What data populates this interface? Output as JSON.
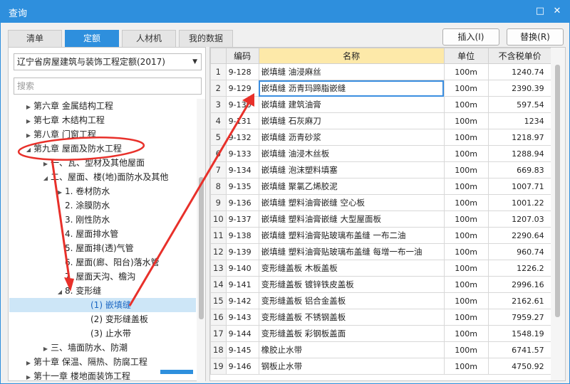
{
  "window": {
    "title": "查询",
    "max_glyph": "□",
    "close_glyph": "✕"
  },
  "tabs": [
    {
      "label": "清单",
      "active": false
    },
    {
      "label": "定额",
      "active": true
    },
    {
      "label": "人材机",
      "active": false
    },
    {
      "label": "我的数据",
      "active": false
    }
  ],
  "actions": {
    "insert_label": "插入(I)",
    "replace_label": "替换(R)"
  },
  "left": {
    "library": "辽宁省房屋建筑与装饰工程定额(2017)",
    "search_placeholder": "搜索",
    "tree": [
      {
        "label": "第六章 金属结构工程",
        "level": 0,
        "toggle": "▶"
      },
      {
        "label": "第七章 木结构工程",
        "level": 0,
        "toggle": "▶"
      },
      {
        "label": "第八章 门窗工程",
        "level": 0,
        "toggle": "▶"
      },
      {
        "label": "第九章 屋面及防水工程",
        "level": 0,
        "toggle": "◢"
      },
      {
        "label": "一、瓦、型材及其他屋面",
        "level": 1,
        "toggle": "▶"
      },
      {
        "label": "二、屋面、楼(地)面防水及其他",
        "level": 1,
        "toggle": "◢"
      },
      {
        "label": "1. 卷材防水",
        "level": 2,
        "toggle": "▶"
      },
      {
        "label": "2. 涂膜防水",
        "level": 2,
        "toggle": ""
      },
      {
        "label": "3. 刚性防水",
        "level": 2,
        "toggle": ""
      },
      {
        "label": "4. 屋面排水管",
        "level": 2,
        "toggle": ""
      },
      {
        "label": "5. 屋面排(透)气管",
        "level": 2,
        "toggle": ""
      },
      {
        "label": "6. 屋面(廊、阳台)落水管",
        "level": 2,
        "toggle": ""
      },
      {
        "label": "7. 屋面天沟、檐沟",
        "level": 2,
        "toggle": ""
      },
      {
        "label": "8. 变形缝",
        "level": 2,
        "toggle": "◢"
      },
      {
        "label": "(1) 嵌填缝",
        "level": 3,
        "toggle": "",
        "selected": true
      },
      {
        "label": "(2) 变形缝盖板",
        "level": 3,
        "toggle": ""
      },
      {
        "label": "(3) 止水带",
        "level": 3,
        "toggle": ""
      },
      {
        "label": "三、墙面防水、防潮",
        "level": 1,
        "toggle": "▶"
      },
      {
        "label": "第十章 保温、隔热、防腐工程",
        "level": 0,
        "toggle": "▶"
      },
      {
        "label": "第十一章 楼地面装饰工程",
        "level": 0,
        "toggle": "▶"
      }
    ]
  },
  "table": {
    "headers": {
      "no": "",
      "code": "编码",
      "name": "名称",
      "unit": "单位",
      "price": "不含税单价"
    },
    "rows": [
      {
        "no": "1",
        "code": "9-128",
        "name": "嵌填缝 油浸麻丝",
        "unit": "100m",
        "price": "1240.74"
      },
      {
        "no": "2",
        "code": "9-129",
        "name": "嵌填缝 沥青玛蹄脂嵌缝",
        "unit": "100m",
        "price": "2390.39",
        "selected": true
      },
      {
        "no": "3",
        "code": "9-130",
        "name": "嵌填缝 建筑油膏",
        "unit": "100m",
        "price": "597.54"
      },
      {
        "no": "4",
        "code": "9-131",
        "name": "嵌填缝 石灰麻刀",
        "unit": "100m",
        "price": "1234"
      },
      {
        "no": "5",
        "code": "9-132",
        "name": "嵌填缝 沥青砂浆",
        "unit": "100m",
        "price": "1218.97"
      },
      {
        "no": "6",
        "code": "9-133",
        "name": "嵌填缝 油浸木丝板",
        "unit": "100m",
        "price": "1288.94"
      },
      {
        "no": "7",
        "code": "9-134",
        "name": "嵌填缝 泡沫塑料填塞",
        "unit": "100m",
        "price": "669.83"
      },
      {
        "no": "8",
        "code": "9-135",
        "name": "嵌填缝 聚氯乙烯胶泥",
        "unit": "100m",
        "price": "1007.71"
      },
      {
        "no": "9",
        "code": "9-136",
        "name": "嵌填缝 塑料油膏嵌缝 空心板",
        "unit": "100m",
        "price": "1001.22"
      },
      {
        "no": "10",
        "code": "9-137",
        "name": "嵌填缝 塑料油膏嵌缝 大型屋面板",
        "unit": "100m",
        "price": "1207.03"
      },
      {
        "no": "11",
        "code": "9-138",
        "name": "嵌填缝 塑料油膏贴玻璃布盖缝 一布二油",
        "unit": "100m",
        "price": "2290.64"
      },
      {
        "no": "12",
        "code": "9-139",
        "name": "嵌填缝 塑料油膏贴玻璃布盖缝 每增一布一油",
        "unit": "100m",
        "price": "960.74"
      },
      {
        "no": "13",
        "code": "9-140",
        "name": "变形缝盖板 木板盖板",
        "unit": "100m",
        "price": "1226.2"
      },
      {
        "no": "14",
        "code": "9-141",
        "name": "变形缝盖板 镀锌铁皮盖板",
        "unit": "100m",
        "price": "2996.16"
      },
      {
        "no": "15",
        "code": "9-142",
        "name": "变形缝盖板 铝合金盖板",
        "unit": "100m",
        "price": "2162.61"
      },
      {
        "no": "16",
        "code": "9-143",
        "name": "变形缝盖板 不锈钢盖板",
        "unit": "100m",
        "price": "7959.27"
      },
      {
        "no": "17",
        "code": "9-144",
        "name": "变形缝盖板 彩钢板盖面",
        "unit": "100m",
        "price": "1548.19"
      },
      {
        "no": "18",
        "code": "9-145",
        "name": "橡胶止水带",
        "unit": "100m",
        "price": "6741.57"
      },
      {
        "no": "19",
        "code": "9-146",
        "name": "钢板止水带",
        "unit": "100m",
        "price": "4750.92"
      }
    ]
  },
  "colors": {
    "accent": "#2e8fdd",
    "annotation": "#e8302a",
    "name_header": "#fde9a9"
  }
}
